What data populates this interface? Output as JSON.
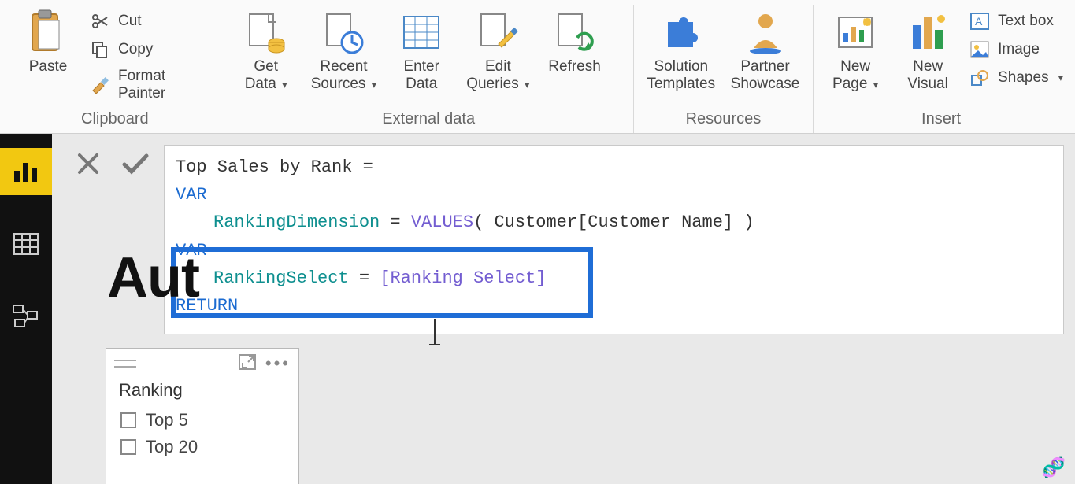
{
  "ribbon": {
    "clipboard": {
      "label": "Clipboard",
      "paste": "Paste",
      "cut": "Cut",
      "copy": "Copy",
      "format_painter": "Format Painter"
    },
    "external_data": {
      "label": "External data",
      "get_data": "Get\nData",
      "recent_sources": "Recent\nSources",
      "enter_data": "Enter\nData",
      "edit_queries": "Edit\nQueries",
      "refresh": "Refresh"
    },
    "resources": {
      "label": "Resources",
      "solution_templates": "Solution\nTemplates",
      "partner_showcase": "Partner\nShowcase"
    },
    "insert": {
      "label": "Insert",
      "new_page": "New\nPage",
      "new_visual": "New\nVisual",
      "text_box": "Text box",
      "image": "Image",
      "shapes": "Shapes"
    }
  },
  "formula": {
    "line1_a": "Top Sales by Rank ",
    "line1_b": "=",
    "var": "VAR",
    "line2_a": "RankingDimension",
    "line2_b": " = ",
    "line2_c": "VALUES",
    "line2_d": "( Customer[Customer Name] )",
    "line3_a": "RankingSelect",
    "line3_b": " = ",
    "line3_c": "[Ranking Select]",
    "return": "RETURN"
  },
  "report": {
    "title_fragment": "Aut"
  },
  "slicer": {
    "title": "Ranking",
    "items": [
      "Top 5",
      "Top 20"
    ]
  },
  "caret": "▾"
}
